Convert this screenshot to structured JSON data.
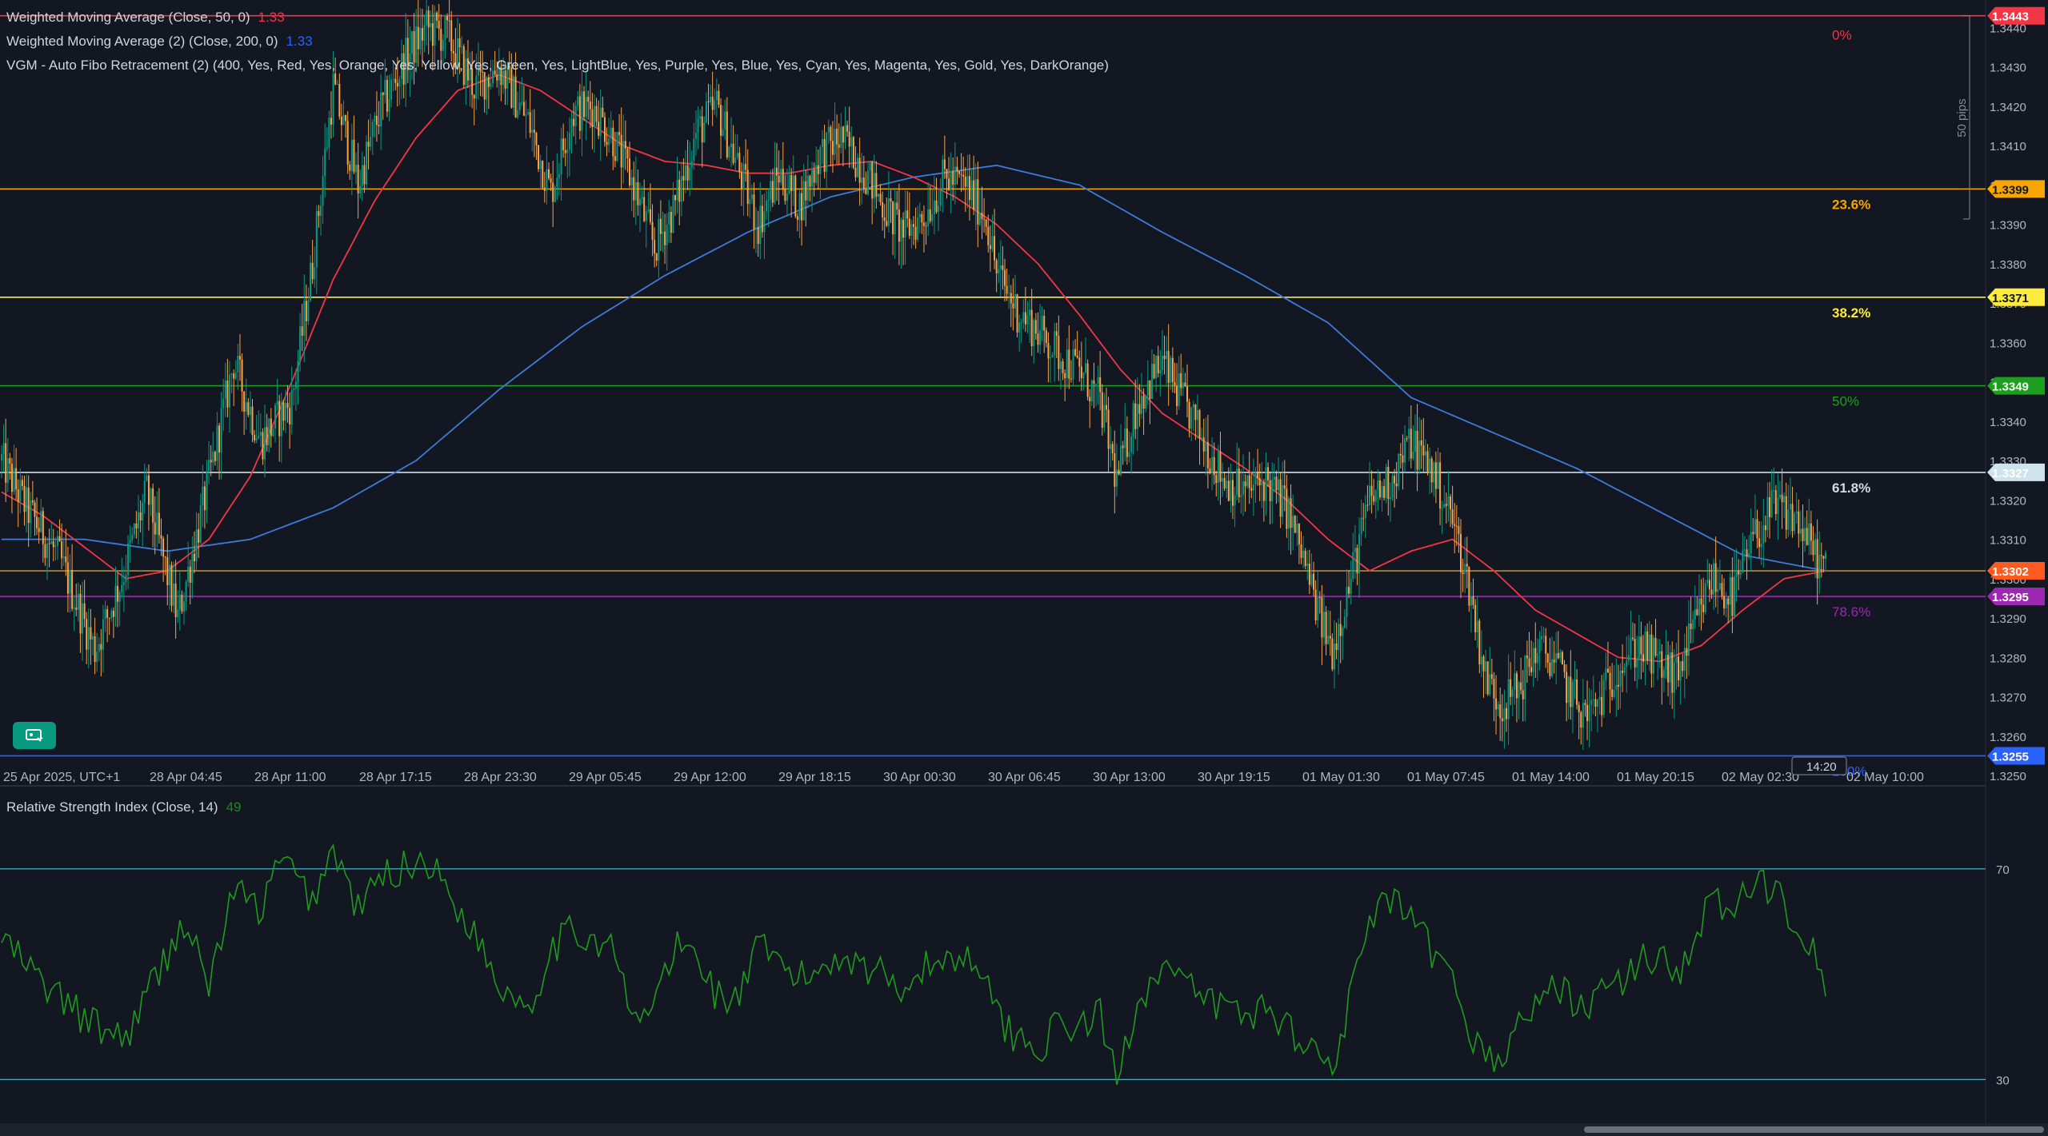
{
  "legend": {
    "wma50": {
      "label": "Weighted Moving Average (Close, 50, 0)",
      "value": "1.33",
      "color": "#f23645"
    },
    "wma200": {
      "label": "Weighted Moving Average (2) (Close, 200, 0)",
      "value": "1.33",
      "color": "#2962ff"
    },
    "fibo": {
      "label": "VGM - Auto Fibo Retracement (2) (400, Yes, Red, Yes, Orange, Yes, Yellow, Yes, Green, Yes, LightBlue, Yes, Purple, Yes, Blue, Yes, Cyan, Yes, Magenta, Yes, Gold, Yes, DarkOrange)"
    },
    "rsi": {
      "label": "Relative Strength Index (Close, 14)",
      "value": "49",
      "color": "#1b8a1b"
    }
  },
  "colors": {
    "background": "#131722",
    "up": "#089981",
    "down": "#f7a44a",
    "wma50": "#f23645",
    "wma200": "#3d7bd9",
    "rsi": "#1f9a1f",
    "rsi_band": "#4ec3d8"
  },
  "chart_data": [
    {
      "type": "candlestick",
      "timeframe_start": "25 Apr 2025, UTC+1",
      "x_tick_labels": [
        "25 Apr 2025, UTC+1",
        "28 Apr 04:45",
        "28 Apr 11:00",
        "28 Apr 17:15",
        "28 Apr 23:30",
        "29 Apr 05:45",
        "29 Apr 12:00",
        "29 Apr 18:15",
        "30 Apr 00:30",
        "30 Apr 06:45",
        "30 Apr 13:00",
        "30 Apr 19:15",
        "01 May 01:30",
        "01 May 07:45",
        "01 May 14:00",
        "01 May 20:15",
        "02 May 02:30",
        "02 May 10:00"
      ],
      "y_tick_labels": [
        "1.3440",
        "1.3430",
        "1.3420",
        "1.3410",
        "1.3400",
        "1.3390",
        "1.3380",
        "1.3370",
        "1.3360",
        "1.3350",
        "1.3340",
        "1.3330",
        "1.3320",
        "1.3310",
        "1.3300",
        "1.3290",
        "1.3280",
        "1.3270",
        "1.3260",
        "1.3250"
      ],
      "ylim": [
        1.3249,
        1.3447
      ],
      "price_path": [
        [
          0,
          1.333
        ],
        [
          12,
          1.3318
        ],
        [
          28,
          1.3305
        ],
        [
          45,
          1.3282
        ],
        [
          58,
          1.33
        ],
        [
          70,
          1.3322
        ],
        [
          85,
          1.329
        ],
        [
          100,
          1.3325
        ],
        [
          112,
          1.3355
        ],
        [
          125,
          1.3335
        ],
        [
          140,
          1.3345
        ],
        [
          150,
          1.338
        ],
        [
          160,
          1.3425
        ],
        [
          172,
          1.34
        ],
        [
          182,
          1.3418
        ],
        [
          195,
          1.3432
        ],
        [
          205,
          1.344
        ],
        [
          215,
          1.3438
        ],
        [
          228,
          1.3425
        ],
        [
          240,
          1.343
        ],
        [
          255,
          1.3415
        ],
        [
          265,
          1.3398
        ],
        [
          275,
          1.3418
        ],
        [
          285,
          1.342
        ],
        [
          295,
          1.3412
        ],
        [
          305,
          1.34
        ],
        [
          315,
          1.3384
        ],
        [
          325,
          1.3395
        ],
        [
          335,
          1.3413
        ],
        [
          345,
          1.342
        ],
        [
          355,
          1.3405
        ],
        [
          365,
          1.339
        ],
        [
          375,
          1.3403
        ],
        [
          385,
          1.3395
        ],
        [
          395,
          1.3408
        ],
        [
          405,
          1.3412
        ],
        [
          415,
          1.3405
        ],
        [
          425,
          1.3395
        ],
        [
          435,
          1.3388
        ],
        [
          445,
          1.3392
        ],
        [
          455,
          1.3402
        ],
        [
          465,
          1.34
        ],
        [
          475,
          1.3392
        ],
        [
          480,
          1.3378
        ],
        [
          490,
          1.3368
        ],
        [
          500,
          1.3363
        ],
        [
          510,
          1.3357
        ],
        [
          520,
          1.3353
        ],
        [
          530,
          1.3345
        ],
        [
          538,
          1.3325
        ],
        [
          548,
          1.3345
        ],
        [
          560,
          1.3355
        ],
        [
          570,
          1.3345
        ],
        [
          580,
          1.3335
        ],
        [
          590,
          1.3325
        ],
        [
          600,
          1.3322
        ],
        [
          610,
          1.3325
        ],
        [
          620,
          1.3318
        ],
        [
          628,
          1.3305
        ],
        [
          636,
          1.329
        ],
        [
          642,
          1.3282
        ],
        [
          650,
          1.3298
        ],
        [
          660,
          1.332
        ],
        [
          670,
          1.3325
        ],
        [
          680,
          1.3335
        ],
        [
          690,
          1.3328
        ],
        [
          700,
          1.3315
        ],
        [
          708,
          1.3298
        ],
        [
          716,
          1.3275
        ],
        [
          724,
          1.3268
        ],
        [
          732,
          1.3272
        ],
        [
          740,
          1.3282
        ],
        [
          748,
          1.328
        ],
        [
          756,
          1.3272
        ],
        [
          764,
          1.3265
        ],
        [
          770,
          1.3268
        ],
        [
          780,
          1.3278
        ],
        [
          790,
          1.3283
        ],
        [
          800,
          1.3278
        ],
        [
          808,
          1.3275
        ],
        [
          815,
          1.3285
        ],
        [
          825,
          1.33
        ],
        [
          835,
          1.3295
        ],
        [
          845,
          1.331
        ],
        [
          855,
          1.3318
        ],
        [
          865,
          1.3316
        ],
        [
          875,
          1.3306
        ],
        [
          880,
          1.3302
        ]
      ],
      "wma50_path": [
        [
          0,
          1.3322
        ],
        [
          20,
          1.3316
        ],
        [
          40,
          1.3308
        ],
        [
          60,
          1.33
        ],
        [
          80,
          1.3302
        ],
        [
          100,
          1.331
        ],
        [
          120,
          1.3326
        ],
        [
          140,
          1.335
        ],
        [
          160,
          1.3376
        ],
        [
          180,
          1.3396
        ],
        [
          200,
          1.3412
        ],
        [
          220,
          1.3424
        ],
        [
          240,
          1.3428
        ],
        [
          260,
          1.3424
        ],
        [
          280,
          1.3417
        ],
        [
          300,
          1.341
        ],
        [
          320,
          1.3406
        ],
        [
          340,
          1.3405
        ],
        [
          360,
          1.3403
        ],
        [
          380,
          1.3403
        ],
        [
          400,
          1.3405
        ],
        [
          420,
          1.3406
        ],
        [
          440,
          1.3402
        ],
        [
          460,
          1.3397
        ],
        [
          480,
          1.339
        ],
        [
          500,
          1.338
        ],
        [
          520,
          1.3367
        ],
        [
          540,
          1.3353
        ],
        [
          560,
          1.3342
        ],
        [
          580,
          1.3335
        ],
        [
          600,
          1.3328
        ],
        [
          620,
          1.332
        ],
        [
          640,
          1.331
        ],
        [
          660,
          1.3302
        ],
        [
          680,
          1.3307
        ],
        [
          700,
          1.331
        ],
        [
          720,
          1.3302
        ],
        [
          740,
          1.3292
        ],
        [
          760,
          1.3286
        ],
        [
          780,
          1.328
        ],
        [
          800,
          1.3279
        ],
        [
          820,
          1.3283
        ],
        [
          840,
          1.3292
        ],
        [
          860,
          1.33
        ],
        [
          880,
          1.3302
        ]
      ],
      "wma200_path": [
        [
          0,
          1.331
        ],
        [
          40,
          1.331
        ],
        [
          80,
          1.3307
        ],
        [
          120,
          1.331
        ],
        [
          160,
          1.3318
        ],
        [
          200,
          1.333
        ],
        [
          240,
          1.3348
        ],
        [
          280,
          1.3364
        ],
        [
          320,
          1.3377
        ],
        [
          360,
          1.3388
        ],
        [
          400,
          1.3397
        ],
        [
          440,
          1.3402
        ],
        [
          480,
          1.3405
        ],
        [
          520,
          1.34
        ],
        [
          560,
          1.3388
        ],
        [
          600,
          1.3377
        ],
        [
          640,
          1.3365
        ],
        [
          680,
          1.3346
        ],
        [
          720,
          1.3337
        ],
        [
          760,
          1.3328
        ],
        [
          800,
          1.3317
        ],
        [
          840,
          1.3306
        ],
        [
          880,
          1.3302
        ]
      ],
      "fib_levels": [
        {
          "label": "0%",
          "price": 1.3443,
          "price_label": "1.3443",
          "color": "#f23645"
        },
        {
          "label": "23.6%",
          "price": 1.3399,
          "price_label": "1.3399",
          "color": "#f7a600"
        },
        {
          "label": "38.2%",
          "price": 1.33715,
          "price_label": "1.3371",
          "color": "#ffeb3b"
        },
        {
          "label": "50%",
          "price": 1.3349,
          "price_label": "1.3349",
          "color": "#1e9e1e"
        },
        {
          "label": "61.8%",
          "price": 1.3327,
          "price_label": "1.3327",
          "color": "#d1dce6"
        },
        {
          "label": "78.6%",
          "price": 1.32955,
          "price_label": "1.3295",
          "color": "#9c27b0"
        },
        {
          "label": "100%",
          "price": 1.3255,
          "price_label": "1.3255",
          "color": "#2962ff"
        }
      ],
      "current_price": {
        "price": 1.3302,
        "price_label": "1.3302",
        "color": "#ff5a1f"
      },
      "measure": {
        "label": "50 pips",
        "from": 1.3443,
        "to": 1.3393
      },
      "crosshair_time": "14:20"
    },
    {
      "type": "line",
      "name": "Relative Strength Index (Close, 14)",
      "ylim": [
        22,
        85
      ],
      "bands": [
        70,
        30
      ],
      "y_tick_labels": [
        "70",
        "30"
      ],
      "path": [
        [
          0,
          57
        ],
        [
          20,
          48
        ],
        [
          45,
          40
        ],
        [
          60,
          38
        ],
        [
          75,
          50
        ],
        [
          88,
          60
        ],
        [
          100,
          48
        ],
        [
          112,
          66
        ],
        [
          125,
          62
        ],
        [
          135,
          72
        ],
        [
          150,
          64
        ],
        [
          160,
          74
        ],
        [
          172,
          62
        ],
        [
          182,
          68
        ],
        [
          192,
          70
        ],
        [
          205,
          72
        ],
        [
          218,
          64
        ],
        [
          228,
          58
        ],
        [
          240,
          48
        ],
        [
          255,
          44
        ],
        [
          265,
          55
        ],
        [
          275,
          58
        ],
        [
          285,
          57
        ],
        [
          295,
          55
        ],
        [
          305,
          40
        ],
        [
          315,
          45
        ],
        [
          325,
          55
        ],
        [
          335,
          54
        ],
        [
          345,
          46
        ],
        [
          355,
          45
        ],
        [
          365,
          55
        ],
        [
          375,
          52
        ],
        [
          385,
          49
        ],
        [
          395,
          51
        ],
        [
          405,
          54
        ],
        [
          415,
          52
        ],
        [
          425,
          50
        ],
        [
          435,
          48
        ],
        [
          445,
          51
        ],
        [
          455,
          53
        ],
        [
          465,
          53
        ],
        [
          475,
          52
        ],
        [
          480,
          42
        ],
        [
          490,
          38
        ],
        [
          500,
          36
        ],
        [
          510,
          40
        ],
        [
          520,
          40
        ],
        [
          530,
          42
        ],
        [
          538,
          30
        ],
        [
          548,
          45
        ],
        [
          560,
          52
        ],
        [
          570,
          48
        ],
        [
          580,
          45
        ],
        [
          590,
          44
        ],
        [
          600,
          42
        ],
        [
          610,
          44
        ],
        [
          620,
          40
        ],
        [
          628,
          38
        ],
        [
          636,
          34
        ],
        [
          642,
          33
        ],
        [
          650,
          44
        ],
        [
          660,
          60
        ],
        [
          670,
          64
        ],
        [
          680,
          60
        ],
        [
          690,
          54
        ],
        [
          700,
          48
        ],
        [
          708,
          40
        ],
        [
          716,
          34
        ],
        [
          724,
          34
        ],
        [
          732,
          40
        ],
        [
          740,
          45
        ],
        [
          748,
          47
        ],
        [
          756,
          46
        ],
        [
          764,
          44
        ],
        [
          770,
          46
        ],
        [
          780,
          48
        ],
        [
          790,
          52
        ],
        [
          800,
          54
        ],
        [
          808,
          50
        ],
        [
          815,
          55
        ],
        [
          825,
          64
        ],
        [
          835,
          62
        ],
        [
          845,
          66
        ],
        [
          855,
          67
        ],
        [
          865,
          60
        ],
        [
          875,
          55
        ],
        [
          880,
          49
        ]
      ]
    }
  ]
}
